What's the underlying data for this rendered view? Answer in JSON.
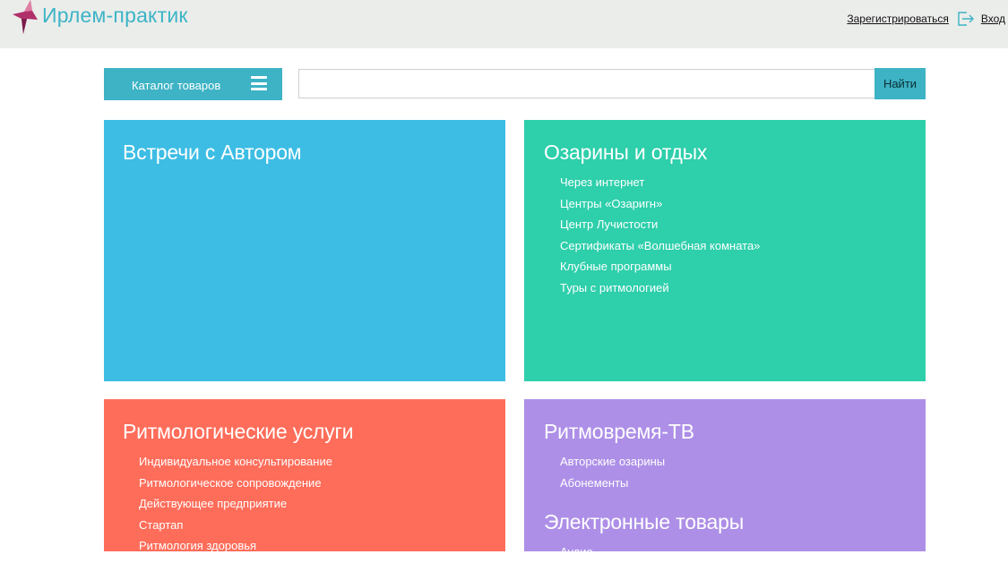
{
  "header": {
    "brand": "Ирлем-практик",
    "register_label": "Зарегистрироваться",
    "login_label": "Вход"
  },
  "toolbar": {
    "catalog_label": "Каталог товаров",
    "search_placeholder": "",
    "search_button": "Найти"
  },
  "tiles": [
    {
      "title": "Встречи с Автором",
      "color": "#3dbde4",
      "items": []
    },
    {
      "title": "Озарины и отдых",
      "color": "#2ecfab",
      "items": [
        "Через интернет",
        "Центры «Озаригн»",
        "Центр Лучистости",
        "Сертификаты «Волшебная комната»",
        "Клубные программы",
        "Туры с ритмологией"
      ]
    },
    {
      "title": "Ритмологические услуги",
      "color": "#fe6d5a",
      "items": [
        "Индивидуальное консультирование",
        "Ритмологическое сопровождение",
        "Действующее предприятие",
        "Стартап",
        "Ритмология здоровья"
      ]
    },
    {
      "title": "Ритмовремя-ТВ",
      "color": "#ad8fe7",
      "items": [
        "Авторские озарины",
        "Абонементы"
      ],
      "sub_title": "Электронные товары",
      "sub_items": [
        "Аудио"
      ]
    }
  ],
  "colors": {
    "accent": "#3db3c5",
    "header_bg": "#ebedeb",
    "logo_magenta": "#b0306a"
  }
}
